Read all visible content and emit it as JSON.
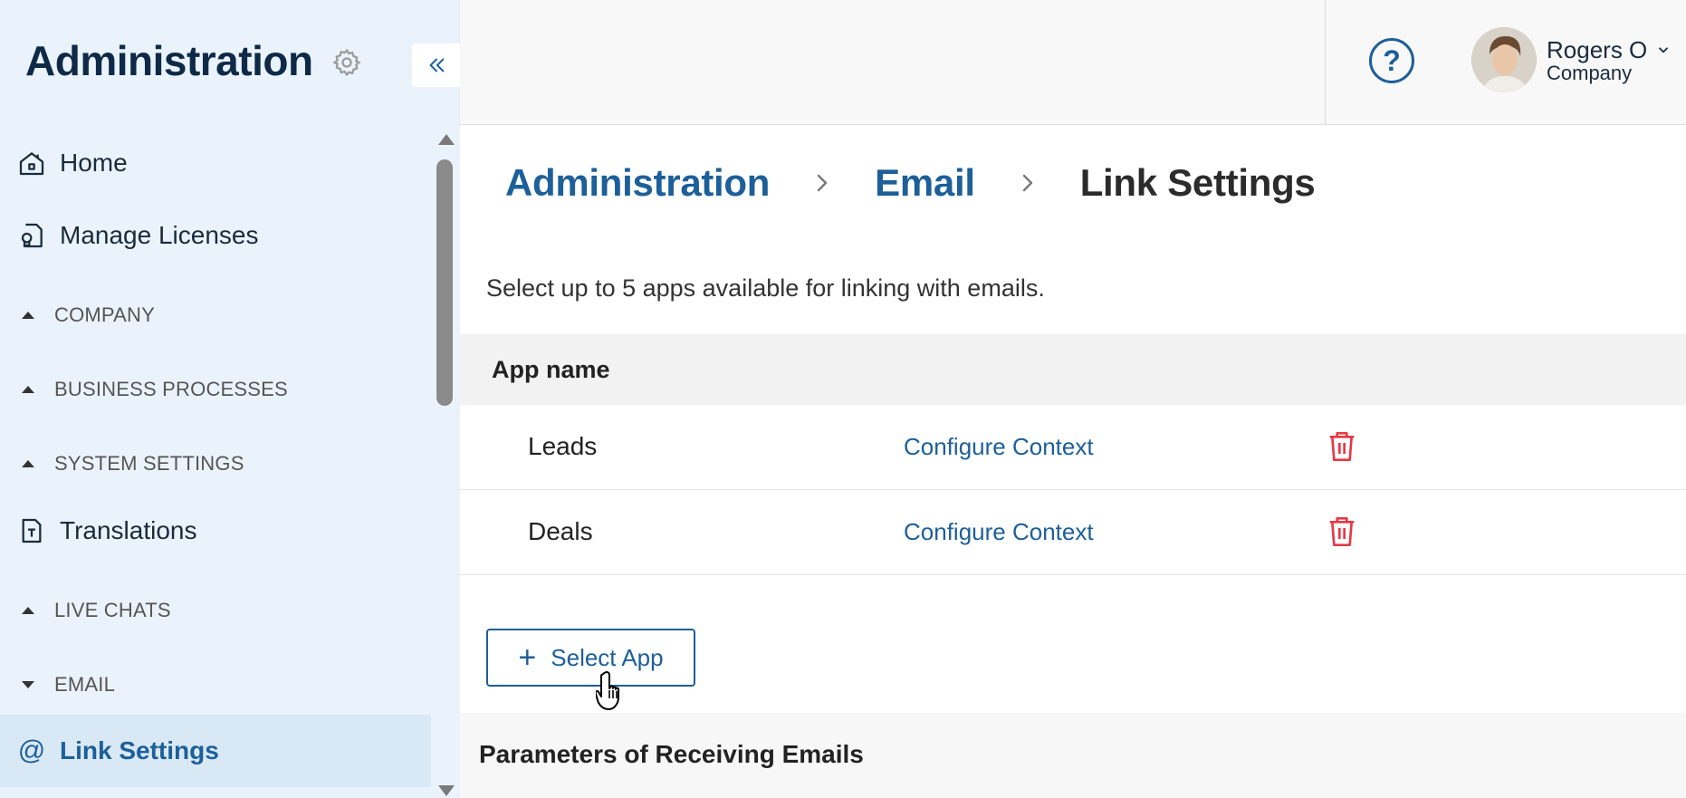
{
  "sidebar": {
    "title": "Administration",
    "collapse_icon": "double-chevron-left-icon",
    "items": [
      {
        "label": "Home",
        "icon": "home-icon"
      },
      {
        "label": "Manage Licenses",
        "icon": "license-icon"
      },
      {
        "label": "COMPANY",
        "type": "section",
        "state": "collapsed"
      },
      {
        "label": "BUSINESS PROCESSES",
        "type": "section",
        "state": "collapsed"
      },
      {
        "label": "SYSTEM SETTINGS",
        "type": "section",
        "state": "collapsed"
      },
      {
        "label": "Translations",
        "icon": "translation-icon"
      },
      {
        "label": "LIVE CHATS",
        "type": "section",
        "state": "collapsed"
      },
      {
        "label": "EMAIL",
        "type": "section",
        "state": "expanded"
      },
      {
        "label": "Link Settings",
        "icon": "at-sign-icon",
        "active": true,
        "icon_glyph": "@"
      }
    ]
  },
  "header": {
    "help_label": "?",
    "user": {
      "name": "Rogers O",
      "company": "Company"
    }
  },
  "breadcrumb": {
    "items": [
      "Administration",
      "Email",
      "Link Settings"
    ]
  },
  "main": {
    "description": "Select up to 5 apps available for linking with emails.",
    "table": {
      "column_header": "App name",
      "rows": [
        {
          "app": "Leads",
          "action": "Configure Context"
        },
        {
          "app": "Deals",
          "action": "Configure Context"
        }
      ]
    },
    "select_app_button": {
      "icon": "+",
      "label": "Select App"
    },
    "parameters_title": "Parameters of Receiving Emails"
  },
  "colors": {
    "accent": "#1d5f99",
    "sidebar_bg": "#eaf3fb",
    "delete": "#e53945",
    "title": "#0e2a47"
  }
}
